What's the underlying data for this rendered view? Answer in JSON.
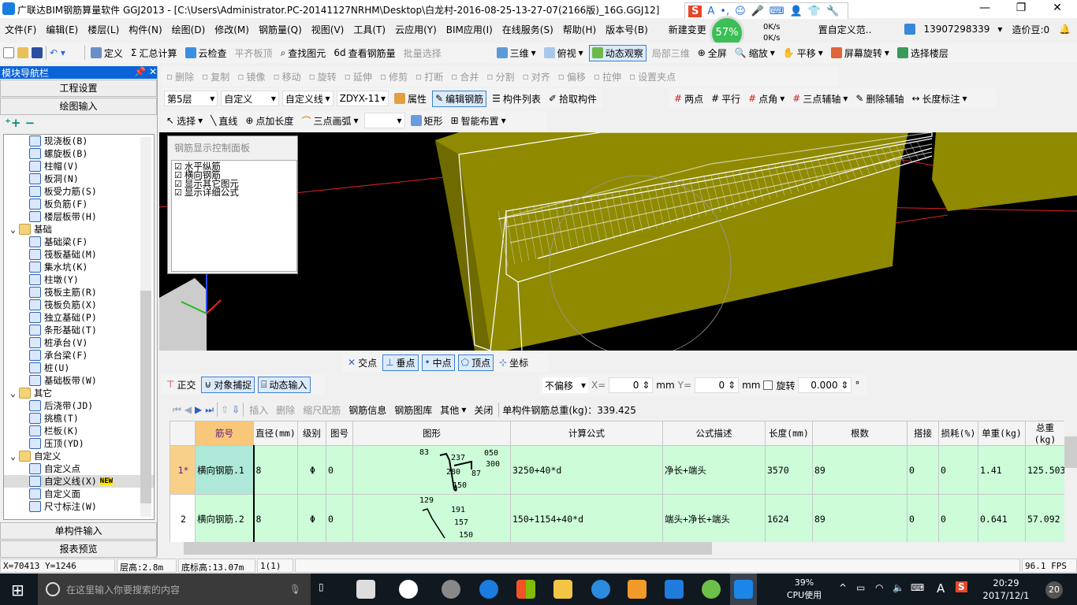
{
  "title": "广联达BIM钢筋算量软件 GGJ2013 - [C:\\Users\\Administrator.PC-20141127NRHM\\Desktop\\白龙村-2016-08-25-13-27-07(2166版)_16G.GGJ12]",
  "menu": [
    "文件(F)",
    "编辑(E)",
    "楼层(L)",
    "构件(N)",
    "绘图(D)",
    "修改(M)",
    "钢筋量(Q)",
    "视图(V)",
    "工具(T)",
    "云应用(Y)",
    "BIM应用(I)",
    "在线服务(S)",
    "帮助(H)",
    "版本号(B)"
  ],
  "menu_extra": {
    "new_change": "新建变更",
    "custom_range": "置自定义范..",
    "user": "13907298339",
    "beans": "造价豆:0"
  },
  "monitor": {
    "percent": "57%",
    "up": "0K/s",
    "down": "0K/s"
  },
  "toolbar1": [
    "定义",
    "汇总计算",
    "云检查",
    "平齐板顶",
    "查找图元",
    "查看钢筋量",
    "批量选择",
    "三维",
    "俯视",
    "动态观察",
    "局部三维",
    "全屏",
    "缩放",
    "平移",
    "屏幕旋转",
    "选择楼层"
  ],
  "toolbar2": [
    "删除",
    "复制",
    "镜像",
    "移动",
    "旋转",
    "延伸",
    "修剪",
    "打断",
    "合并",
    "分割",
    "对齐",
    "偏移",
    "拉伸",
    "设置夹点"
  ],
  "toolbar3": {
    "floor": "第5层",
    "type": "自定义",
    "sub": "自定义线",
    "code": "ZDYX-11",
    "items": [
      "属性",
      "编辑钢筋",
      "构件列表",
      "拾取构件"
    ],
    "right": [
      "两点",
      "平行",
      "点角",
      "三点辅轴",
      "删除辅轴",
      "长度标注"
    ]
  },
  "toolbar4": [
    "选择",
    "直线",
    "点加长度",
    "三点画弧",
    "矩形",
    "智能布置"
  ],
  "nav": {
    "title": "模块导航栏",
    "top_buttons": [
      "工程设置",
      "绘图输入"
    ],
    "bottom_buttons": [
      "单构件输入",
      "报表预览"
    ],
    "tree": [
      {
        "l": "现浇板(B)",
        "d": 2
      },
      {
        "l": "螺旋板(B)",
        "d": 2
      },
      {
        "l": "柱帽(V)",
        "d": 2
      },
      {
        "l": "板洞(N)",
        "d": 2
      },
      {
        "l": "板受力筋(S)",
        "d": 2
      },
      {
        "l": "板负筋(F)",
        "d": 2
      },
      {
        "l": "楼层板带(H)",
        "d": 2
      },
      {
        "l": "基础",
        "d": 1
      },
      {
        "l": "基础梁(F)",
        "d": 2
      },
      {
        "l": "筏板基础(M)",
        "d": 2
      },
      {
        "l": "集水坑(K)",
        "d": 2
      },
      {
        "l": "柱墩(Y)",
        "d": 2
      },
      {
        "l": "筏板主筋(R)",
        "d": 2
      },
      {
        "l": "筏板负筋(X)",
        "d": 2
      },
      {
        "l": "独立基础(P)",
        "d": 2
      },
      {
        "l": "条形基础(T)",
        "d": 2
      },
      {
        "l": "桩承台(V)",
        "d": 2
      },
      {
        "l": "承台梁(F)",
        "d": 2
      },
      {
        "l": "桩(U)",
        "d": 2
      },
      {
        "l": "基础板带(W)",
        "d": 2
      },
      {
        "l": "其它",
        "d": 1
      },
      {
        "l": "后浇带(JD)",
        "d": 2
      },
      {
        "l": "挑檐(T)",
        "d": 2
      },
      {
        "l": "栏板(K)",
        "d": 2
      },
      {
        "l": "压顶(YD)",
        "d": 2
      },
      {
        "l": "自定义",
        "d": 1
      },
      {
        "l": "自定义点",
        "d": 2
      },
      {
        "l": "自定义线(X)",
        "d": 2,
        "new": "NEW"
      },
      {
        "l": "自定义面",
        "d": 2
      },
      {
        "l": "尺寸标注(W)",
        "d": 2
      }
    ]
  },
  "rebar_panel": {
    "title": "钢筋显示控制面板",
    "options": [
      "水平纵筋",
      "横向钢筋",
      "显示其它图元",
      "显示详细公式"
    ]
  },
  "snap": [
    "交点",
    "垂点",
    "中点",
    "顶点",
    "坐标"
  ],
  "draw_opts": {
    "ortho": "正交",
    "snap": "对象捕捉",
    "dyn": "动态输入",
    "offset": "不偏移",
    "x_label": "X=",
    "x": "0",
    "mm1": "mm",
    "y_label": "Y=",
    "y": "0",
    "mm2": "mm",
    "rotate": "旋转",
    "angle": "0.000",
    "deg": "°"
  },
  "grid_toolbar": {
    "items": [
      "插入",
      "删除",
      "缩尺配筋",
      "钢筋信息",
      "钢筋图库",
      "其他",
      "关闭"
    ],
    "total": "单构件钢筋总重(kg)：339.425"
  },
  "table": {
    "headers": [
      "",
      "筋号",
      "直径(mm)",
      "级别",
      "图号",
      "图形",
      "计算公式",
      "公式描述",
      "长度(mm)",
      "根数",
      "搭接",
      "损耗(%)",
      "单重(kg)",
      "总重(kg)"
    ],
    "rows": [
      [
        "1*",
        "横向钢筋.1",
        "8",
        "Φ",
        "0",
        "",
        "3250+40*d",
        "净长+端头",
        "3570",
        "89",
        "0",
        "0",
        "1.41",
        "125.503"
      ],
      [
        "2",
        "横向钢筋.2",
        "8",
        "Φ",
        "0",
        "",
        "150+1154+40*d",
        "端头+净长+端头",
        "1624",
        "89",
        "0",
        "0",
        "0.641",
        "57.092"
      ]
    ],
    "shape1": [
      "83",
      "237",
      "050",
      "300",
      "280",
      "87",
      "150"
    ],
    "shape2": [
      "129",
      "191",
      "157",
      "150"
    ]
  },
  "status": {
    "coord": "X=70413 Y=1246",
    "floor_h": "层高:2.8m",
    "base": "底标高:13.07m",
    "count": "1(1)",
    "fps": "96.1 FPS"
  },
  "taskbar": {
    "search": "在这里输入你要搜索的内容",
    "cpu": "39%",
    "cpu_label": "CPU使用",
    "time": "20:29",
    "date": "2017/12/1",
    "notif": "20"
  }
}
